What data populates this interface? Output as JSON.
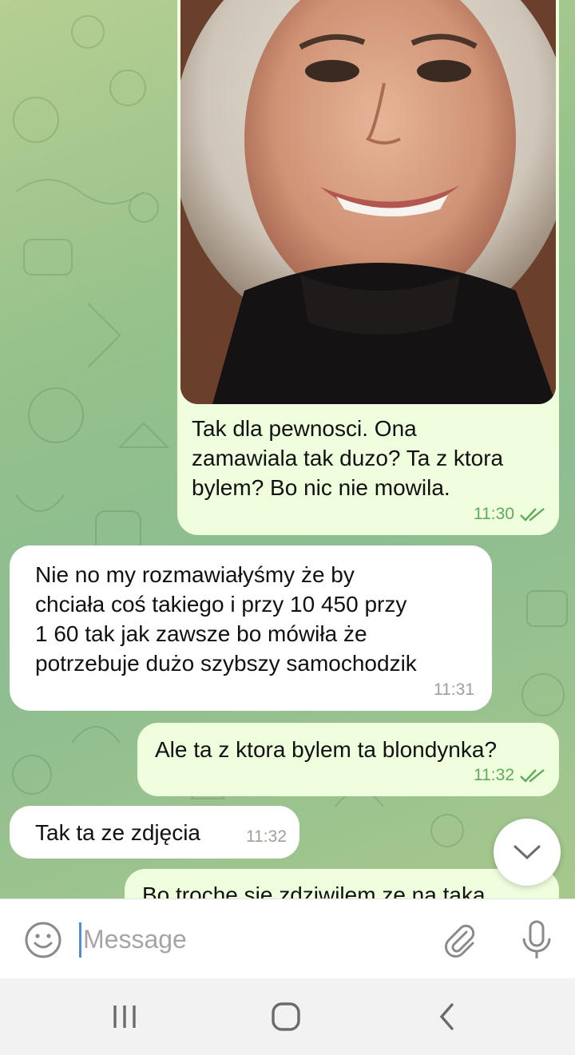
{
  "messages": [
    {
      "type": "photo",
      "direction": "outgoing",
      "photo_description_icon": "portrait-photo",
      "text": "Tak dla pewnosci. Ona\nzamawiala tak duzo? Ta z ktora\nbylem? Bo nic nie mowila.",
      "time": "11:30",
      "status": "read"
    },
    {
      "direction": "incoming",
      "text": "Nie no my rozmawiałyśmy że by\nchciała coś takiego i przy 10 450 przy\n1 60 tak jak zawsze bo mówiła że\npotrzebuje dużo szybszy samochodzik",
      "time": "11:31"
    },
    {
      "direction": "outgoing",
      "text": "Ale ta z ktora bylem ta blondynka?",
      "time": "11:32",
      "status": "read"
    },
    {
      "direction": "incoming",
      "text": "Tak ta ze zdjęcia",
      "time": "11:32"
    },
    {
      "direction": "outgoing",
      "text": "Bo troche sie zdziwilem ze na taka",
      "partially_visible": true
    }
  ],
  "composer": {
    "placeholder": "Message"
  },
  "icons": {
    "emoji": "emoji-icon",
    "attach": "paperclip-icon",
    "mic": "microphone-icon",
    "scroll_down": "chevron-down-icon",
    "read_receipt": "double-check-icon",
    "nav_recents": "recents-icon",
    "nav_home": "home-icon",
    "nav_back": "back-icon"
  },
  "colors": {
    "outgoing_bubble": "#effedd",
    "incoming_bubble": "#ffffff",
    "outgoing_meta": "#5fab5c",
    "incoming_meta": "#9aa39a",
    "chat_background": "#9fc58d"
  }
}
